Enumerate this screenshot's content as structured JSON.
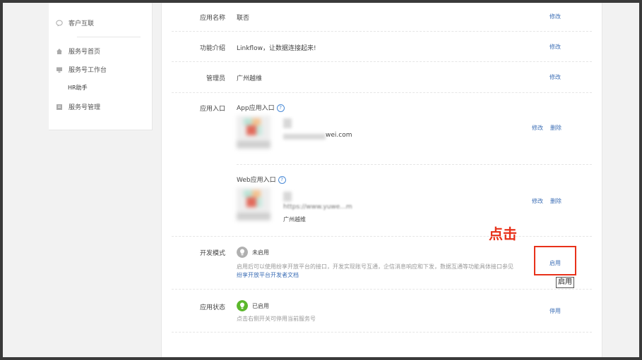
{
  "sidebar": {
    "top_item": {
      "label": "客户互联",
      "icon": "chat-bubble-icon"
    },
    "items": [
      {
        "label": "服务号首页",
        "icon": "home-icon"
      },
      {
        "label": "服务号工作台",
        "icon": "monitor-icon"
      },
      {
        "label": "HR助手",
        "icon": null
      },
      {
        "label": "服务号管理",
        "icon": "manage-icon"
      }
    ]
  },
  "rows": {
    "app_name": {
      "label": "应用名称",
      "value": "联否",
      "action": "修改"
    },
    "intro": {
      "label": "功能介绍",
      "value": "Linkflow，让数据连接起来!",
      "action": "修改"
    },
    "admin": {
      "label": "管理员",
      "value": "广州越维",
      "action": "修改"
    },
    "entry": {
      "label": "应用入口",
      "app": {
        "title": "App应用入口",
        "url_fragment": "wei.com",
        "actions": [
          "修改",
          "删除"
        ]
      },
      "web": {
        "title": "Web应用入口",
        "url_fragment": "https://www.yuwe...m",
        "owner": "广州越维",
        "actions": [
          "修改",
          "删除"
        ]
      }
    },
    "dev_mode": {
      "label": "开发模式",
      "status": "未启用",
      "desc": "启用后可以使用纷享开放平台的接口，开发实现账号互通，企信消息响应和下发，数据互通等功能具体接口参见",
      "link": "纷享开放平台开发者文档",
      "action": "启用"
    },
    "app_status": {
      "label": "应用状态",
      "status": "已启用",
      "desc": "点击右侧开关可停用当前服务号",
      "action": "停用"
    }
  },
  "annotation": {
    "text": "点击",
    "tooltip": "启用"
  },
  "colors": {
    "link": "#3d6fb6",
    "annotation": "#e8311a",
    "enabled": "#5cb82c",
    "disabled": "#b0b0b0"
  }
}
